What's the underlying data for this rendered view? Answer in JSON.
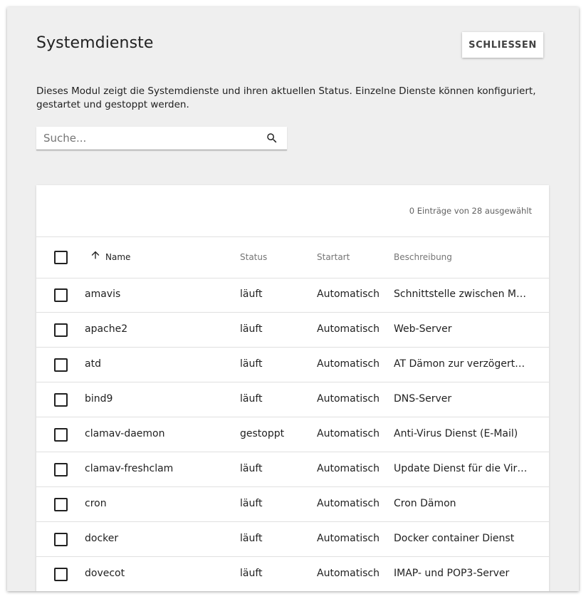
{
  "header": {
    "title": "Systemdienste",
    "close_label": "SCHLIESSEN"
  },
  "description": "Dieses Modul zeigt die Systemdienste und ihren aktuellen Status. Einzelne Dienste können konfiguriert, gestartet und gestoppt werden.",
  "search": {
    "placeholder": "Suche...",
    "value": "",
    "icon": "search-icon"
  },
  "grid": {
    "selection_info": "0 Einträge von 28 ausgewählt",
    "columns": {
      "name": "Name",
      "status": "Status",
      "start_type": "Startart",
      "description": "Beschreibung"
    },
    "sort": {
      "column": "name",
      "direction": "ascending",
      "icon": "arrow-up-icon"
    },
    "rows": [
      {
        "name": "amavis",
        "status": "läuft",
        "start_type": "Automatisch",
        "description": "Schnittstelle zwischen Mail-S…"
      },
      {
        "name": "apache2",
        "status": "läuft",
        "start_type": "Automatisch",
        "description": "Web-Server"
      },
      {
        "name": "atd",
        "status": "läuft",
        "start_type": "Automatisch",
        "description": "AT Dämon zur verzögerten A…"
      },
      {
        "name": "bind9",
        "status": "läuft",
        "start_type": "Automatisch",
        "description": "DNS-Server"
      },
      {
        "name": "clamav-daemon",
        "status": "gestoppt",
        "start_type": "Automatisch",
        "description": "Anti-Virus Dienst (E-Mail)"
      },
      {
        "name": "clamav-freshclam",
        "status": "läuft",
        "start_type": "Automatisch",
        "description": "Update Dienst für die Virus-D…"
      },
      {
        "name": "cron",
        "status": "läuft",
        "start_type": "Automatisch",
        "description": "Cron Dämon"
      },
      {
        "name": "docker",
        "status": "läuft",
        "start_type": "Automatisch",
        "description": "Docker container Dienst"
      },
      {
        "name": "dovecot",
        "status": "läuft",
        "start_type": "Automatisch",
        "description": "IMAP- und POP3-Server"
      }
    ]
  }
}
